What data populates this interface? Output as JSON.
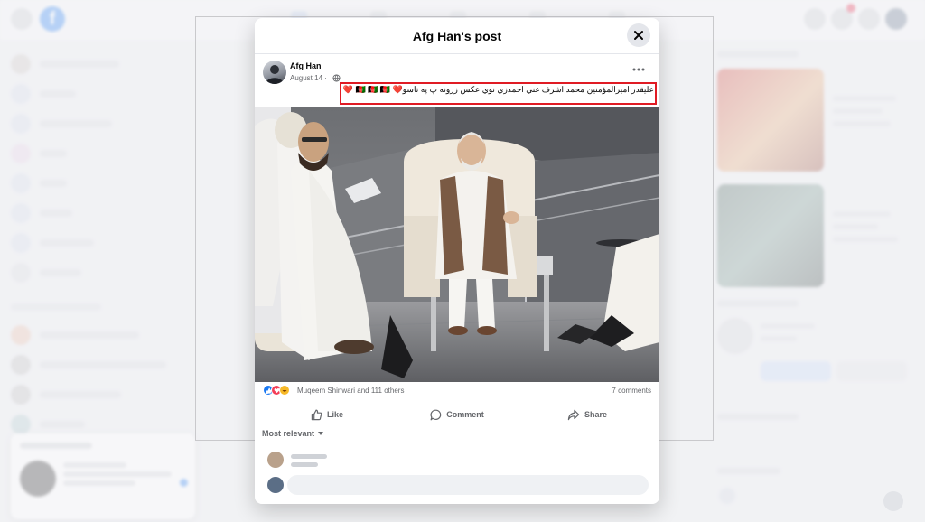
{
  "modal": {
    "title": "Afg Han's post",
    "close_label": "Close"
  },
  "post": {
    "author": "Afg Han",
    "date": "August 14 ·",
    "caption": "عليقدر اميرالمؤمنين محمد اشرف غني احمدزي نوي عکس زرونه پ په تاسو❤️ 🇦🇫 🇦🇫 🇦🇫 ❤️",
    "reactions_text": "Muqeem Shinwari and 111 others",
    "comments_count": "7 comments"
  },
  "actions": {
    "like": "Like",
    "comment": "Comment",
    "share": "Share"
  },
  "comments": {
    "sort_label": "Most relevant"
  },
  "colors": {
    "accent": "#1877f2",
    "highlight_box": "#e01b24",
    "reaction_like": "#1877f2",
    "reaction_love": "#f33e58",
    "reaction_haha": "#f7b928"
  },
  "icons": [
    "close-icon",
    "more-icon",
    "globe-icon",
    "like-icon",
    "comment-icon",
    "share-icon",
    "chevron-down-icon"
  ]
}
